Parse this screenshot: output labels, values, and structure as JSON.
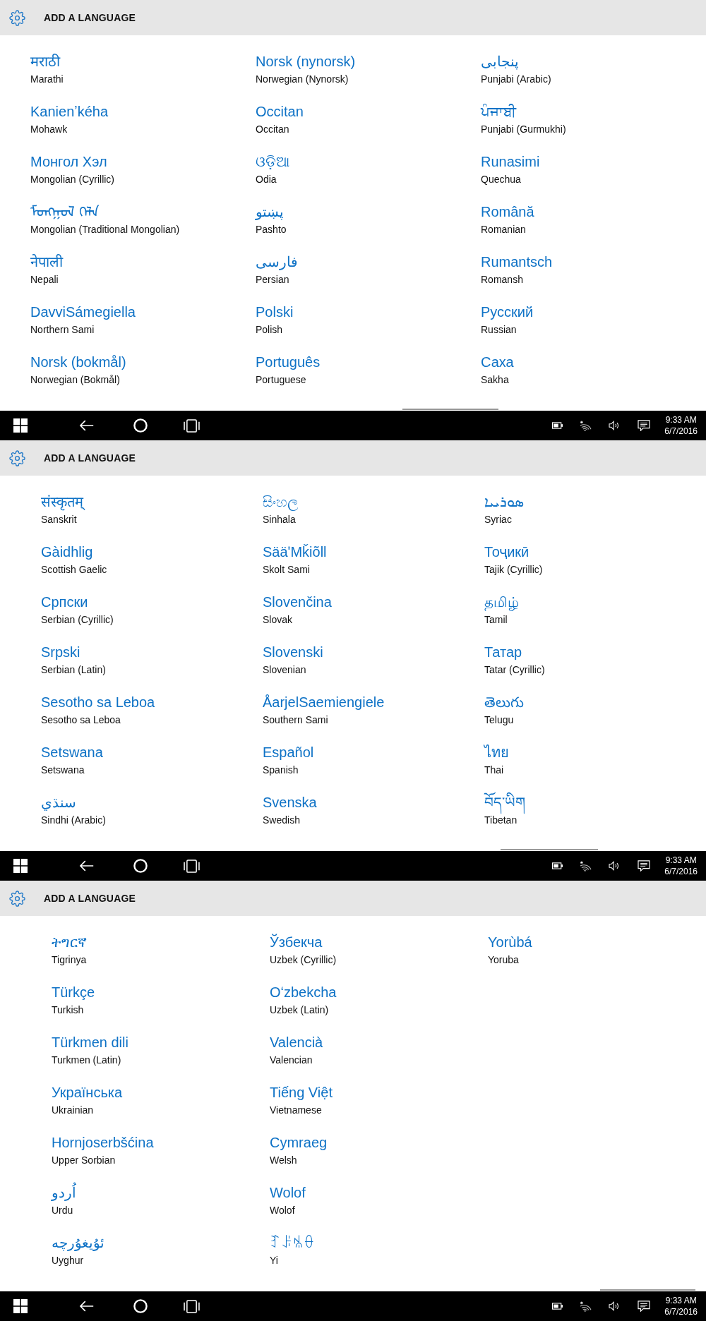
{
  "screens": [
    {
      "header": {
        "title": "ADD A LANGUAGE"
      },
      "columns": [
        [
          {
            "native": "मराठी",
            "english": "Marathi"
          },
          {
            "native": "Kanienʼkéha",
            "english": "Mohawk"
          },
          {
            "native": "Монгол Хэл",
            "english": "Mongolian (Cyrillic)"
          },
          {
            "native": "ᠮᠣᠩᠭᠣᠯ ᠬᠡᠯᠡ",
            "english": "Mongolian (Traditional Mongolian)"
          },
          {
            "native": "नेपाली",
            "english": "Nepali"
          },
          {
            "native": "DavviSámegiella",
            "english": "Northern Sami"
          },
          {
            "native": "Norsk (bokmål)",
            "english": "Norwegian (Bokmål)"
          }
        ],
        [
          {
            "native": "Norsk (nynorsk)",
            "english": "Norwegian (Nynorsk)"
          },
          {
            "native": "Occitan",
            "english": "Occitan"
          },
          {
            "native": "ଓଡ଼ିଆ",
            "english": "Odia"
          },
          {
            "native": "پښتو",
            "english": "Pashto"
          },
          {
            "native": "فارسى",
            "english": "Persian"
          },
          {
            "native": "Polski",
            "english": "Polish"
          },
          {
            "native": "Português",
            "english": "Portuguese"
          }
        ],
        [
          {
            "native": "پنجابی",
            "english": "Punjabi (Arabic)"
          },
          {
            "native": "ਪੰਜਾਬੀ",
            "english": "Punjabi (Gurmukhi)"
          },
          {
            "native": "Runasimi",
            "english": "Quechua"
          },
          {
            "native": "Română",
            "english": "Romanian"
          },
          {
            "native": "Rumantsch",
            "english": "Romansh"
          },
          {
            "native": "Русский",
            "english": "Russian"
          },
          {
            "native": "Саха",
            "english": "Sakha"
          }
        ]
      ],
      "taskbar": {
        "time": "9:33 AM",
        "date": "6/7/2016"
      }
    },
    {
      "header": {
        "title": "ADD A LANGUAGE"
      },
      "columns": [
        [
          {
            "native": "संस्कृतम्",
            "english": "Sanskrit"
          },
          {
            "native": "Gàidhlig",
            "english": "Scottish Gaelic"
          },
          {
            "native": "Српски",
            "english": "Serbian (Cyrillic)"
          },
          {
            "native": "Srpski",
            "english": "Serbian (Latin)"
          },
          {
            "native": "Sesotho sa Leboa",
            "english": "Sesotho sa Leboa"
          },
          {
            "native": "Setswana",
            "english": "Setswana"
          },
          {
            "native": "سنڌي",
            "english": "Sindhi (Arabic)"
          }
        ],
        [
          {
            "native": "සිංහල",
            "english": "Sinhala"
          },
          {
            "native": "SääʹMǩiõll",
            "english": "Skolt Sami"
          },
          {
            "native": "Slovenčina",
            "english": "Slovak"
          },
          {
            "native": "Slovenski",
            "english": "Slovenian"
          },
          {
            "native": "ÅarjelSaemiengiele",
            "english": "Southern Sami"
          },
          {
            "native": "Español",
            "english": "Spanish"
          },
          {
            "native": "Svenska",
            "english": "Swedish"
          }
        ],
        [
          {
            "native": "ܣܘܪܝܝܐ",
            "english": "Syriac"
          },
          {
            "native": "Тоҷикӣ",
            "english": "Tajik (Cyrillic)"
          },
          {
            "native": "தமிழ்",
            "english": "Tamil"
          },
          {
            "native": "Татар",
            "english": "Tatar (Cyrillic)"
          },
          {
            "native": "తెలుగు",
            "english": "Telugu"
          },
          {
            "native": "ไทย",
            "english": "Thai"
          },
          {
            "native": "བོད་ཡིག",
            "english": "Tibetan"
          }
        ]
      ],
      "taskbar": {
        "time": "9:33 AM",
        "date": "6/7/2016"
      }
    },
    {
      "header": {
        "title": "ADD A LANGUAGE"
      },
      "columns": [
        [
          {
            "native": "ትግርኛ",
            "english": "Tigrinya"
          },
          {
            "native": "Türkçe",
            "english": "Turkish"
          },
          {
            "native": "Türkmen dili",
            "english": "Turkmen (Latin)"
          },
          {
            "native": "Українська",
            "english": "Ukrainian"
          },
          {
            "native": "Hornjoserbšćina",
            "english": "Upper Sorbian"
          },
          {
            "native": "اُردو",
            "english": "Urdu"
          },
          {
            "native": "ئۇيغۇرچە",
            "english": "Uyghur"
          }
        ],
        [
          {
            "native": "Ўзбекча",
            "english": "Uzbek (Cyrillic)"
          },
          {
            "native": "Oʻzbekcha",
            "english": "Uzbek (Latin)"
          },
          {
            "native": "Valencià",
            "english": "Valencian"
          },
          {
            "native": "Tiếng Việt",
            "english": "Vietnamese"
          },
          {
            "native": "Cymraeg",
            "english": "Welsh"
          },
          {
            "native": "Wolof",
            "english": "Wolof"
          },
          {
            "native": "ꆈꌠꁱꂷ",
            "english": "Yi"
          }
        ],
        [
          {
            "native": "Yorùbá",
            "english": "Yoruba"
          }
        ]
      ],
      "taskbar": {
        "time": "9:33 AM",
        "date": "6/7/2016"
      }
    }
  ]
}
